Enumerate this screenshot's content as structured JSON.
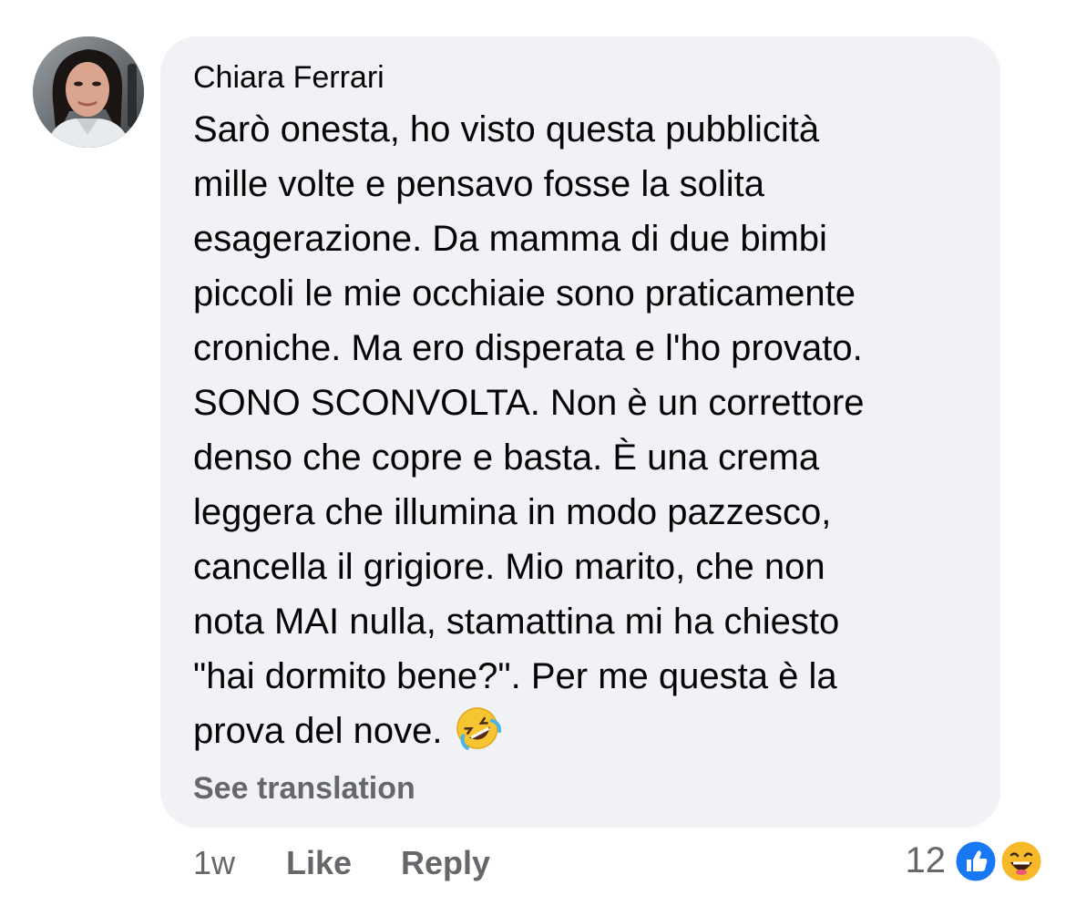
{
  "comment": {
    "author": "Chiara Ferrari",
    "lines": [
      "Sarò onesta, ho visto questa pubblicità",
      "mille volte e pensavo fosse la solita",
      "esagerazione. Da mamma di due bimbi",
      "piccoli le mie occhiaie sono praticamente",
      "croniche. Ma ero disperata e l'ho provato.",
      "SONO SCONVOLTA. Non è un correttore",
      "denso che copre e basta. È una crema",
      "leggera che illumina in modo pazzesco,",
      "cancella il grigiore. Mio marito, che non",
      "nota MAI nulla, stamattina mi ha chiesto",
      "\"hai dormito bene?\". Per me questa è la",
      "prova del nove."
    ],
    "trailing_emoji": "rolling-on-floor-laughing-emoji",
    "see_translation": "See translation"
  },
  "actions": {
    "time": "1w",
    "like": "Like",
    "reply": "Reply"
  },
  "reactions": {
    "count": "12",
    "icons": [
      "like-reaction-icon",
      "haha-reaction-icon"
    ]
  },
  "colors": {
    "bubble": "#f0f2f5",
    "secondary_text": "#65676b",
    "like_blue": "#1877f2",
    "haha_yellow": "#f7b928"
  }
}
